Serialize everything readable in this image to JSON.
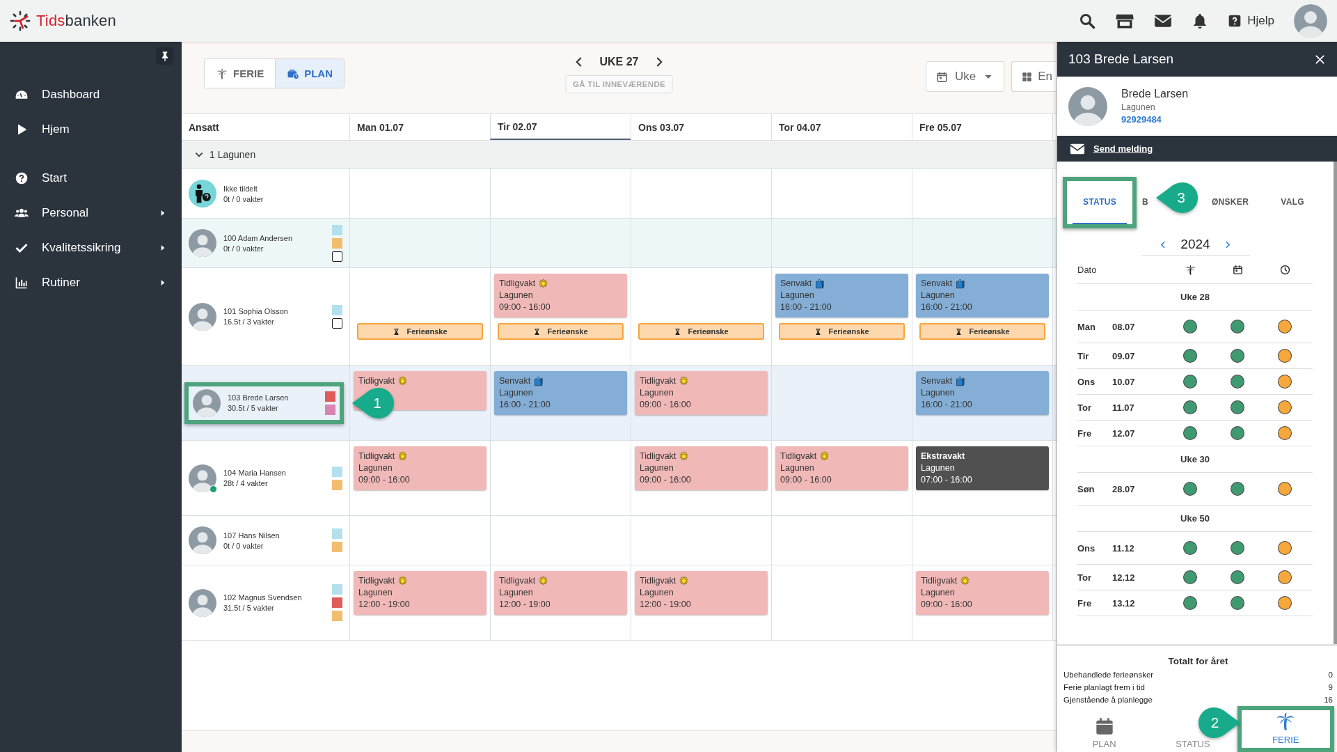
{
  "header": {
    "logo": {
      "first": "Tids",
      "second": "banken"
    },
    "help": "Hjelp"
  },
  "sidebar": {
    "items": [
      {
        "label": "Dashboard",
        "submenu": false
      },
      {
        "label": "Hjem",
        "submenu": false
      },
      {
        "label": "Start",
        "submenu": false
      },
      {
        "label": "Personal",
        "submenu": true
      },
      {
        "label": "Kvalitetssikring",
        "submenu": true
      },
      {
        "label": "Rutiner",
        "submenu": true
      }
    ]
  },
  "toolbar": {
    "modes": [
      {
        "label": "FERIE",
        "selected": false
      },
      {
        "label": "PLAN",
        "selected": true
      }
    ],
    "week": "UKE 27",
    "today": {
      "label": "GÅ TIL INNEVÆRENDE",
      "disabled": true
    },
    "view": "Uke",
    "layout": "En"
  },
  "table": {
    "columns": [
      {
        "label": "Ansatt",
        "selected": false
      },
      {
        "label": "Man 01.07",
        "selected": false
      },
      {
        "label": "Tir 02.07",
        "selected": true
      },
      {
        "label": "Ons 03.07",
        "selected": false
      },
      {
        "label": "Tor 04.07",
        "selected": false
      },
      {
        "label": "Fre 05.07",
        "selected": false
      }
    ],
    "group": {
      "label": "1 Lagunen",
      "expanded": true
    },
    "rows": [
      {
        "kind": "unassigned",
        "name": "Ikke tildelt",
        "hours": "0t / 0 vakter",
        "online": false,
        "selected": false,
        "hover": false,
        "highlighted": false
      },
      {
        "kind": "employee",
        "name": "100 Adam Andersen",
        "hours": "0t / 0 vakter",
        "online": false,
        "selected": false,
        "hover": true,
        "highlighted": false,
        "tags": [
          {
            "kind": "swatch",
            "color": "#b4e0ee"
          },
          {
            "kind": "swatch",
            "color": "#f2bd6e"
          },
          {
            "kind": "checkbox",
            "checked": false
          }
        ]
      },
      {
        "kind": "employee",
        "name": "101 Sophia Olsson",
        "hours": "16.5t / 3 vakter",
        "online": false,
        "selected": false,
        "hover": false,
        "highlighted": false,
        "tags": [
          {
            "kind": "swatch",
            "color": "#b4e0ee"
          },
          {
            "kind": "checkbox",
            "checked": false
          }
        ],
        "days": {
          "mon": [
            {
              "kind": "request",
              "label": "Ferieønske"
            }
          ],
          "tue": [
            {
              "kind": "early",
              "title": "Tidligvakt",
              "place": "Lagunen",
              "time": "09:00 - 16:00"
            },
            {
              "kind": "request",
              "label": "Ferieønske"
            }
          ],
          "wed": [
            {
              "kind": "request",
              "label": "Ferieønske"
            }
          ],
          "thu": [
            {
              "kind": "late",
              "title": "Senvakt",
              "place": "Lagunen",
              "time": "16:00 - 21:00"
            },
            {
              "kind": "request",
              "label": "Ferieønske"
            }
          ],
          "fri": [
            {
              "kind": "late",
              "title": "Senvakt",
              "place": "Lagunen",
              "time": "16:00 - 21:00"
            },
            {
              "kind": "request",
              "label": "Ferieønske"
            }
          ]
        }
      },
      {
        "kind": "employee",
        "name": "103 Brede Larsen",
        "hours": "30.5t / 5 vakter",
        "online": false,
        "selected": true,
        "hover": false,
        "highlighted": true,
        "callout": "1",
        "tags": [
          {
            "kind": "swatch",
            "color": "#de5d5b"
          },
          {
            "kind": "swatch",
            "color": "#d983b4"
          }
        ],
        "days": {
          "mon": [
            {
              "kind": "early",
              "title": "Tidligvakt"
            }
          ],
          "tue": [
            {
              "kind": "late",
              "title": "Senvakt",
              "place": "Lagunen",
              "time": "16:00 - 21:00"
            }
          ],
          "wed": [
            {
              "kind": "early",
              "title": "Tidligvakt",
              "place": "Lagunen",
              "time": "09:00 - 16:00"
            }
          ],
          "fri": [
            {
              "kind": "late",
              "title": "Senvakt",
              "place": "Lagunen",
              "time": "16:00 - 21:00"
            }
          ]
        }
      },
      {
        "kind": "employee",
        "name": "104 Maria Hansen",
        "hours": "28t / 4 vakter",
        "online": true,
        "selected": false,
        "hover": false,
        "highlighted": false,
        "tags": [
          {
            "kind": "swatch",
            "color": "#b4e0ee"
          },
          {
            "kind": "swatch",
            "color": "#f2bd6e"
          }
        ],
        "days": {
          "mon": [
            {
              "kind": "early",
              "title": "Tidligvakt",
              "place": "Lagunen",
              "time": "09:00 - 16:00"
            }
          ],
          "wed": [
            {
              "kind": "early",
              "title": "Tidligvakt",
              "place": "Lagunen",
              "time": "09:00 - 16:00"
            }
          ],
          "thu": [
            {
              "kind": "early",
              "title": "Tidligvakt",
              "place": "Lagunen",
              "time": "09:00 - 16:00"
            }
          ],
          "fri": [
            {
              "kind": "extra",
              "title": "Ekstravakt",
              "place": "Lagunen",
              "time": "07:00 - 16:00"
            }
          ]
        }
      },
      {
        "kind": "employee",
        "name": "107 Hans Nilsen",
        "hours": "0t / 0 vakter",
        "online": false,
        "selected": false,
        "hover": false,
        "highlighted": false,
        "tags": [
          {
            "kind": "swatch",
            "color": "#b4e0ee"
          },
          {
            "kind": "swatch",
            "color": "#f2bd6e"
          }
        ]
      },
      {
        "kind": "employee",
        "name": "102 Magnus Svendsen",
        "hours": "31.5t / 5 vakter",
        "online": false,
        "selected": false,
        "hover": false,
        "highlighted": false,
        "tags": [
          {
            "kind": "swatch",
            "color": "#b4e0ee"
          },
          {
            "kind": "swatch",
            "color": "#de5d5b"
          },
          {
            "kind": "swatch",
            "color": "#f2bd6e"
          }
        ],
        "days": {
          "mon": [
            {
              "kind": "early",
              "title": "Tidligvakt",
              "place": "Lagunen",
              "time": "12:00 - 19:00"
            }
          ],
          "tue": [
            {
              "kind": "early",
              "title": "Tidligvakt",
              "place": "Lagunen",
              "time": "12:00 - 19:00"
            }
          ],
          "wed": [
            {
              "kind": "early",
              "title": "Tidligvakt",
              "place": "Lagunen",
              "time": "12:00 - 19:00"
            }
          ],
          "fri": [
            {
              "kind": "early",
              "title": "Tidligvakt",
              "place": "Lagunen",
              "time": "09:00 - 16:00"
            }
          ]
        }
      }
    ]
  },
  "panel": {
    "title": "103 Brede Larsen",
    "name": "Brede Larsen",
    "department": "Lagunen",
    "phone": "92929484",
    "message_link": "Send melding",
    "tabs": [
      {
        "label": "STATUS",
        "selected": true,
        "highlighted": true,
        "callout": "3"
      },
      {
        "label": "B",
        "selected": false,
        "highlighted": false
      },
      {
        "label": "ØNSKER",
        "selected": false,
        "highlighted": false
      },
      {
        "label": "VALG",
        "selected": false,
        "highlighted": false
      }
    ],
    "year": "2024",
    "date_column": "Dato",
    "weeks": [
      {
        "label": "Uke 28",
        "days": [
          {
            "day": "Man",
            "date": "08.07",
            "statuses": [
              {
                "color": "#3f9a72"
              },
              {
                "color": "#3f9a72"
              },
              {
                "color": "#f6a83c"
              }
            ]
          },
          {
            "day": "Tir",
            "date": "09.07",
            "statuses": [
              {
                "color": "#3f9a72"
              },
              {
                "color": "#3f9a72"
              },
              {
                "color": "#f6a83c"
              }
            ]
          },
          {
            "day": "Ons",
            "date": "10.07",
            "statuses": [
              {
                "color": "#3f9a72"
              },
              {
                "color": "#3f9a72"
              },
              {
                "color": "#f6a83c"
              }
            ]
          },
          {
            "day": "Tor",
            "date": "11.07",
            "statuses": [
              {
                "color": "#3f9a72"
              },
              {
                "color": "#3f9a72"
              },
              {
                "color": "#f6a83c"
              }
            ]
          },
          {
            "day": "Fre",
            "date": "12.07",
            "statuses": [
              {
                "color": "#3f9a72"
              },
              {
                "color": "#3f9a72"
              },
              {
                "color": "#f6a83c"
              }
            ]
          }
        ]
      },
      {
        "label": "Uke 30",
        "days": [
          {
            "day": "Søn",
            "date": "28.07",
            "statuses": [
              {
                "color": "#3f9a72"
              },
              {
                "color": "#3f9a72"
              },
              {
                "color": "#f6a83c"
              }
            ]
          }
        ]
      },
      {
        "label": "Uke 50",
        "days": [
          {
            "day": "Ons",
            "date": "11.12",
            "statuses": [
              {
                "color": "#3f9a72"
              },
              {
                "color": "#3f9a72"
              },
              {
                "color": "#f6a83c"
              }
            ]
          },
          {
            "day": "Tor",
            "date": "12.12",
            "statuses": [
              {
                "color": "#3f9a72"
              },
              {
                "color": "#3f9a72"
              },
              {
                "color": "#f6a83c"
              }
            ]
          },
          {
            "day": "Fre",
            "date": "13.12",
            "statuses": [
              {
                "color": "#3f9a72"
              },
              {
                "color": "#3f9a72"
              },
              {
                "color": "#f6a83c"
              }
            ]
          }
        ]
      }
    ],
    "totals": {
      "title": "Totalt for året",
      "rows": [
        {
          "label": "Ubehandlede ferieønsker",
          "value": "0"
        },
        {
          "label": "Ferie planlagt frem i tid",
          "value": "9"
        },
        {
          "label": "Gjenstående å planlegge",
          "value": "16"
        }
      ]
    },
    "bottom_nav": [
      {
        "label": "PLAN",
        "selected": false,
        "highlighted": false
      },
      {
        "label": "STATUS",
        "selected": false,
        "highlighted": false
      },
      {
        "label": "FERIE",
        "selected": true,
        "highlighted": true,
        "callout": "2"
      }
    ]
  }
}
